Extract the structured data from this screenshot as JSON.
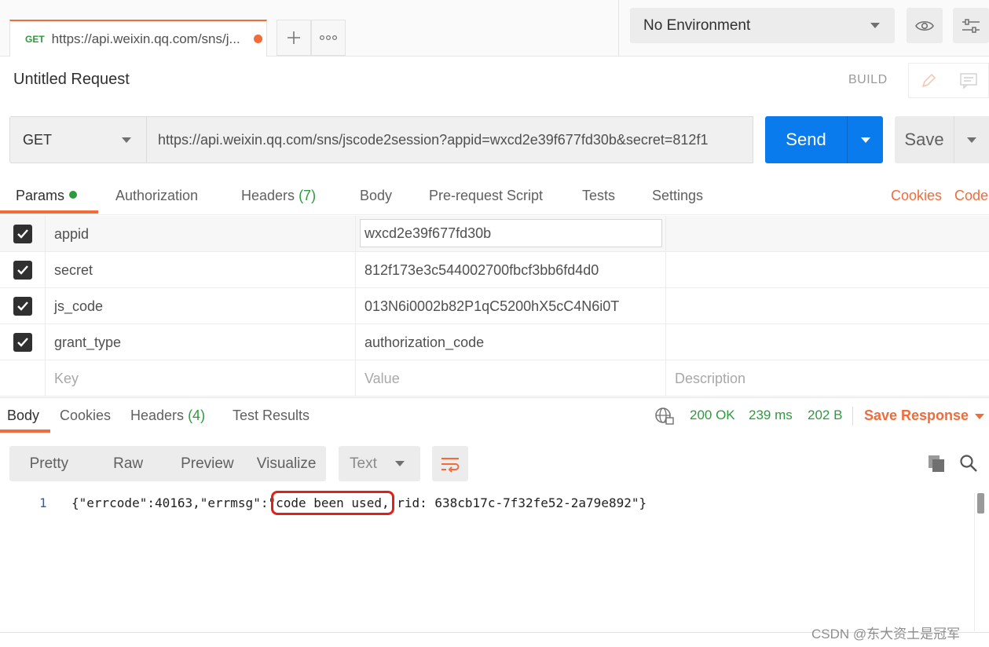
{
  "top": {
    "tab": {
      "method": "GET",
      "url": "https://api.weixin.qq.com/sns/j..."
    },
    "environment": "No Environment"
  },
  "request": {
    "title": "Untitled Request",
    "build_label": "BUILD",
    "method": "GET",
    "url": "https://api.weixin.qq.com/sns/jscode2session?appid=wxcd2e39f677fd30b&secret=812f1",
    "send_label": "Send",
    "save_label": "Save",
    "tabs": {
      "params": "Params",
      "authorization": "Authorization",
      "headers": "Headers",
      "headers_count": "(7)",
      "body": "Body",
      "prerequest": "Pre-request Script",
      "tests": "Tests",
      "settings": "Settings",
      "cookies": "Cookies",
      "code": "Code"
    },
    "params": [
      {
        "key": "appid",
        "value": "wxcd2e39f677fd30b"
      },
      {
        "key": "secret",
        "value": "812f173e3c544002700fbcf3bb6fd4d0"
      },
      {
        "key": "js_code",
        "value": "013N6i0002b82P1qC5200hX5cC4N6i0T"
      },
      {
        "key": "grant_type",
        "value": "authorization_code"
      }
    ],
    "placeholders": {
      "key": "Key",
      "value": "Value",
      "description": "Description"
    }
  },
  "response": {
    "tabs": {
      "body": "Body",
      "cookies": "Cookies",
      "headers": "Headers",
      "headers_count": "(4)",
      "test_results": "Test Results"
    },
    "status": "200 OK",
    "time": "239 ms",
    "size": "202 B",
    "save_response": "Save Response",
    "views": {
      "pretty": "Pretty",
      "raw": "Raw",
      "preview": "Preview",
      "visualize": "Visualize"
    },
    "format": "Text",
    "line_number": "1",
    "code_before": "{\"errcode\":40163,\"errmsg\":\"",
    "code_highlight": "code been used,",
    "code_after": " rid: 638cb17c-7f32fe52-2a79e892\"}"
  },
  "watermark": "CSDN @东大资土是冠军",
  "colors": {
    "accent": "#f26b3a",
    "send": "#097bed",
    "success": "#2d9a3e",
    "highlight": "#e0201a"
  }
}
